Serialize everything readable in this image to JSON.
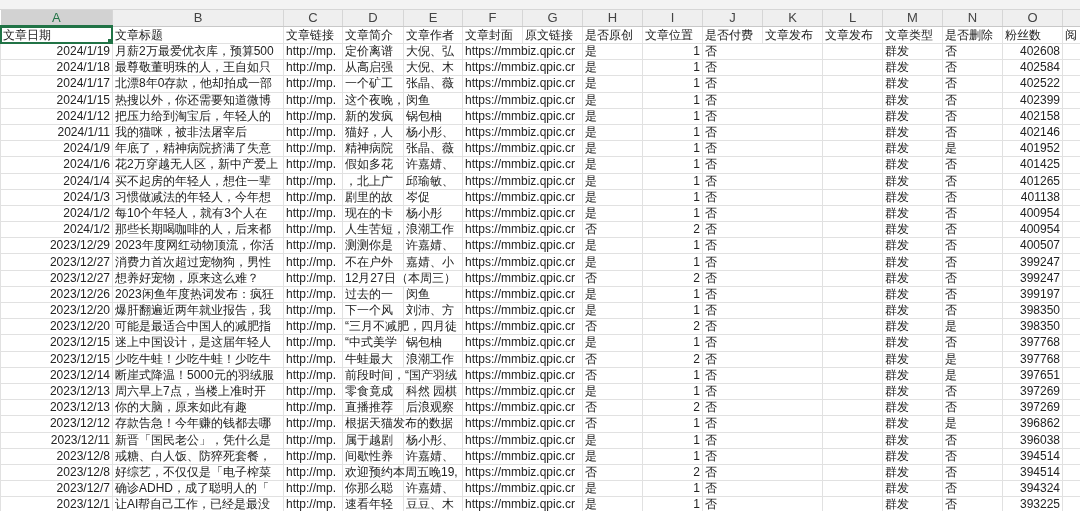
{
  "columns": [
    {
      "letter": "A",
      "header": "文章日期",
      "kind": "number",
      "selected": true
    },
    {
      "letter": "B",
      "header": "文章标题",
      "kind": "text",
      "selected": false
    },
    {
      "letter": "C",
      "header": "文章链接",
      "kind": "text",
      "selected": false
    },
    {
      "letter": "D",
      "header": "文章简介",
      "kind": "text",
      "selected": false
    },
    {
      "letter": "E",
      "header": "文章作者",
      "kind": "text",
      "selected": false
    },
    {
      "letter": "F",
      "header": "文章封面",
      "kind": "text",
      "selected": false
    },
    {
      "letter": "G",
      "header": "原文链接",
      "selected": false
    },
    {
      "letter": "H",
      "header": "是否原创",
      "kind": "text",
      "selected": false
    },
    {
      "letter": "I",
      "header": "文章位置",
      "kind": "number",
      "selected": false
    },
    {
      "letter": "J",
      "header": "是否付费",
      "kind": "text",
      "selected": false
    },
    {
      "letter": "K",
      "header": "文章发布",
      "selected": false
    },
    {
      "letter": "L",
      "header": "文章发布",
      "selected": false
    },
    {
      "letter": "M",
      "header": "文章类型",
      "kind": "text",
      "selected": false
    },
    {
      "letter": "N",
      "header": "是否删除",
      "kind": "text",
      "selected": false
    },
    {
      "letter": "O",
      "header": "粉丝数",
      "kind": "number",
      "selected": false
    },
    {
      "header": "阅",
      "selected": false
    }
  ],
  "rows": [
    {
      "A": "2024/1/19",
      "B": "月薪2万最爱优衣库，预算500",
      "C": "http://mp.",
      "D": "定价离谱",
      "E": "大倪、弘",
      "F": "https://mmbiz.qpic.cr",
      "H": "是",
      "I": "1",
      "J": "否",
      "M": "群发",
      "N": "否",
      "O": "402608"
    },
    {
      "A": "2024/1/18",
      "B": "最尊敬董明珠的人，王自如只",
      "C": "http://mp.",
      "D": "从高启强",
      "E": "大倪、木",
      "F": "https://mmbiz.qpic.cr",
      "H": "是",
      "I": "1",
      "J": "否",
      "M": "群发",
      "N": "否",
      "O": "402584"
    },
    {
      "A": "2024/1/17",
      "B": "北漂8年0存款，他却拍成一部",
      "C": "http://mp.",
      "D": "一个矿工",
      "E": "张晶、薇",
      "F": "https://mmbiz.qpic.cr",
      "H": "是",
      "I": "1",
      "J": "否",
      "M": "群发",
      "N": "否",
      "O": "402522"
    },
    {
      "A": "2024/1/15",
      "B": "热搜以外，你还需要知道微博",
      "C": "http://mp.",
      "D": "这个夜晚，",
      "E": "闵鱼",
      "F": "https://mmbiz.qpic.cr",
      "H": "是",
      "I": "1",
      "J": "否",
      "M": "群发",
      "N": "否",
      "O": "402399"
    },
    {
      "A": "2024/1/12",
      "B": "把压力给到淘宝后，年轻人的",
      "C": "http://mp.",
      "D": "新的发疯",
      "E": "锅包柚",
      "F": "https://mmbiz.qpic.cr",
      "H": "是",
      "I": "1",
      "J": "否",
      "M": "群发",
      "N": "否",
      "O": "402158"
    },
    {
      "A": "2024/1/11",
      "B": "我的猫咪，被非法屠宰后",
      "C": "http://mp.",
      "D": "猫好，人",
      "E": "杨小彤、",
      "F": "https://mmbiz.qpic.cr",
      "H": "是",
      "I": "1",
      "J": "否",
      "M": "群发",
      "N": "否",
      "O": "402146"
    },
    {
      "A": "2024/1/9",
      "B": "年底了，精神病院挤满了失意",
      "C": "http://mp.",
      "D": "精神病院",
      "E": "张晶、薇",
      "F": "https://mmbiz.qpic.cr",
      "H": "是",
      "I": "1",
      "J": "否",
      "M": "群发",
      "N": "是",
      "O": "401952"
    },
    {
      "A": "2024/1/6",
      "B": "花2万穿越无人区，新中产爱上",
      "C": "http://mp.",
      "D": "假如多花",
      "E": "许嘉婧、",
      "F": "https://mmbiz.qpic.cr",
      "H": "是",
      "I": "1",
      "J": "否",
      "M": "群发",
      "N": "否",
      "O": "401425"
    },
    {
      "A": "2024/1/4",
      "B": "买不起房的年轻人，想住一辈",
      "C": "http://mp.",
      "D": "，北上广",
      "E": "邱瑜敏、",
      "F": "https://mmbiz.qpic.cr",
      "H": "是",
      "I": "1",
      "J": "否",
      "M": "群发",
      "N": "否",
      "O": "401265"
    },
    {
      "A": "2024/1/3",
      "B": "习惯做减法的年轻人，今年想",
      "C": "http://mp.",
      "D": "剧里的故",
      "E": "岑促",
      "F": "https://mmbiz.qpic.cr",
      "H": "是",
      "I": "1",
      "J": "否",
      "M": "群发",
      "N": "否",
      "O": "401138"
    },
    {
      "A": "2024/1/2",
      "B": "每10个年轻人，就有3个人在",
      "C": "http://mp.",
      "D": "现在的卡",
      "E": "杨小彤",
      "F": "https://mmbiz.qpic.cr",
      "H": "是",
      "I": "1",
      "J": "否",
      "M": "群发",
      "N": "否",
      "O": "400954"
    },
    {
      "A": "2024/1/2",
      "B": "那些长期喝咖啡的人，后来都",
      "C": "http://mp.",
      "D": "人生苦短，",
      "E": "浪潮工作",
      "F": "https://mmbiz.qpic.cr",
      "H": "否",
      "I": "2",
      "J": "否",
      "M": "群发",
      "N": "否",
      "O": "400954"
    },
    {
      "A": "2023/12/29",
      "B": "2023年度网红动物顶流，你活",
      "C": "http://mp.",
      "D": "测测你是",
      "E": "许嘉婧、",
      "F": "https://mmbiz.qpic.cr",
      "H": "是",
      "I": "1",
      "J": "否",
      "M": "群发",
      "N": "否",
      "O": "400507"
    },
    {
      "A": "2023/12/27",
      "B": "消费力首次超过宠物狗，男性",
      "C": "http://mp.",
      "D": "不在户外",
      "E": "嘉婧、小",
      "F": "https://mmbiz.qpic.cr",
      "H": "是",
      "I": "1",
      "J": "否",
      "M": "群发",
      "N": "否",
      "O": "399247"
    },
    {
      "A": "2023/12/27",
      "B": "想养好宠物，原来这么难？",
      "C": "http://mp.",
      "D": "12月27日（本周三）",
      "F": "https://mmbiz.qpic.cr",
      "H": "否",
      "I": "2",
      "J": "否",
      "M": "群发",
      "N": "否",
      "O": "399247"
    },
    {
      "A": "2023/12/26",
      "B": "2023闲鱼年度热词发布：疯狂",
      "C": "http://mp.",
      "D": "过去的一",
      "E": "闵鱼",
      "F": "https://mmbiz.qpic.cr",
      "H": "是",
      "I": "1",
      "J": "否",
      "M": "群发",
      "N": "否",
      "O": "399197"
    },
    {
      "A": "2023/12/20",
      "B": "爆肝翻遍近两年就业报告，我",
      "C": "http://mp.",
      "D": "下一个风",
      "E": "刘沛、方",
      "F": "https://mmbiz.qpic.cr",
      "H": "是",
      "I": "1",
      "J": "否",
      "M": "群发",
      "N": "否",
      "O": "398350"
    },
    {
      "A": "2023/12/20",
      "B": "可能是最适合中国人的减肥指",
      "C": "http://mp.",
      "D": "“三月不减肥，四月徒",
      "F": "https://mmbiz.qpic.cr",
      "H": "否",
      "I": "2",
      "J": "否",
      "M": "群发",
      "N": "是",
      "O": "398350"
    },
    {
      "A": "2023/12/15",
      "B": "迷上中国设计，是这届年轻人",
      "C": "http://mp.",
      "D": "“中式美学",
      "E": "锅包柚",
      "F": "https://mmbiz.qpic.cr",
      "H": "是",
      "I": "1",
      "J": "否",
      "M": "群发",
      "N": "否",
      "O": "397768"
    },
    {
      "A": "2023/12/15",
      "B": "少吃牛蛙！少吃牛蛙！少吃牛",
      "C": "http://mp.",
      "D": "牛蛙最大",
      "E": "浪潮工作",
      "F": "https://mmbiz.qpic.cr",
      "H": "否",
      "I": "2",
      "J": "否",
      "M": "群发",
      "N": "是",
      "O": "397768"
    },
    {
      "A": "2023/12/14",
      "B": "断崖式降温！5000元的羽绒服",
      "C": "http://mp.",
      "D": "前段时间，“国产羽绒",
      "F": "https://mmbiz.qpic.cr",
      "H": "否",
      "I": "1",
      "J": "否",
      "M": "群发",
      "N": "是",
      "O": "397651"
    },
    {
      "A": "2023/12/13",
      "B": "周六早上7点，当楼上准时开",
      "C": "http://mp.",
      "D": "零食竟成",
      "E": "科然 园棋",
      "F": "https://mmbiz.qpic.cr",
      "H": "是",
      "I": "1",
      "J": "否",
      "M": "群发",
      "N": "否",
      "O": "397269"
    },
    {
      "A": "2023/12/13",
      "B": "你的大脑，原来如此有趣",
      "C": "http://mp.",
      "D": "直播推荐",
      "E": "后浪观察",
      "F": "https://mmbiz.qpic.cr",
      "H": "否",
      "I": "2",
      "J": "否",
      "M": "群发",
      "N": "否",
      "O": "397269"
    },
    {
      "A": "2023/12/12",
      "B": "存款告急！今年赚的钱都去哪",
      "C": "http://mp.",
      "D": "根据天猫发布的数据",
      "F": "https://mmbiz.qpic.cr",
      "H": "否",
      "I": "1",
      "J": "否",
      "M": "群发",
      "N": "是",
      "O": "396862"
    },
    {
      "A": "2023/12/11",
      "B": "新晋「国民老公」，凭什么是",
      "C": "http://mp.",
      "D": "属于越剧",
      "E": "杨小彤、",
      "F": "https://mmbiz.qpic.cr",
      "H": "是",
      "I": "1",
      "J": "否",
      "M": "群发",
      "N": "否",
      "O": "396038"
    },
    {
      "A": "2023/12/8",
      "B": "戒糖、白人饭、防猝死套餐，",
      "C": "http://mp.",
      "D": "间歇性养",
      "E": "许嘉婧、",
      "F": "https://mmbiz.qpic.cr",
      "H": "是",
      "I": "1",
      "J": "否",
      "M": "群发",
      "N": "否",
      "O": "394514"
    },
    {
      "A": "2023/12/8",
      "B": "好综艺，不仅仅是「电子榨菜",
      "C": "http://mp.",
      "D": "欢迎预约本周五晚19,",
      "F": "https://mmbiz.qpic.cr",
      "H": "否",
      "I": "2",
      "J": "否",
      "M": "群发",
      "N": "否",
      "O": "394514"
    },
    {
      "A": "2023/12/7",
      "B": "确诊ADHD，成了聪明人的「",
      "C": "http://mp.",
      "D": "你那么聪",
      "E": "许嘉婧、",
      "F": "https://mmbiz.qpic.cr",
      "H": "是",
      "I": "1",
      "J": "否",
      "M": "群发",
      "N": "否",
      "O": "394324"
    },
    {
      "A": "2023/12/1",
      "B": "让AI帮自己工作，已经是最没",
      "C": "http://mp.",
      "D": "速看年轻",
      "E": "豆豆、木",
      "F": "https://mmbiz.qpic.cr",
      "H": "是",
      "I": "1",
      "J": "否",
      "M": "群发",
      "N": "否",
      "O": "393225"
    }
  ]
}
